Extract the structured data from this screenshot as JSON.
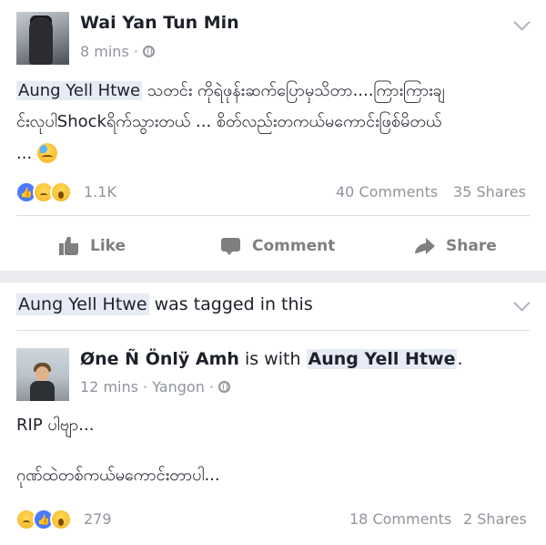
{
  "post1": {
    "author": "Wai Yan Tun Min",
    "time": "8 mins",
    "separator": "·",
    "tag_name": "Aung Yell Htwe",
    "text_line1_rest": " သတင်း ကိုရဲဖုန်းဆက်ပြောမှသိတာ....ကြားကြားချ",
    "text_line2": "င်းလုပါShockရိက်သွားတယ် ... စိတ်လည်းတကယ်မကောင်းဖြစ်မိတယ်",
    "text_line3": "...",
    "reaction_count": "1.1K",
    "comments": "40 Comments",
    "shares": "35 Shares",
    "actions": {
      "like": "Like",
      "comment": "Comment",
      "share": "Share"
    }
  },
  "post2": {
    "tagged_name": "Aung Yell Htwe",
    "tagged_suffix": " was tagged in this",
    "author": "Øne Ñ Önlÿ Amh",
    "with_text": " is with ",
    "with_name": "Aung Yell Htwe",
    "period": ".",
    "time": "12 mins",
    "separator": "·",
    "location": "Yangon",
    "text_line1": "RIP ပါဗျာ...",
    "text_line2": "ဂုဏ်ထဲတစ်ကယ်မကောင်းတာပါ...",
    "reaction_count": "279",
    "comments": "18 Comments",
    "shares": "2 Shares"
  }
}
